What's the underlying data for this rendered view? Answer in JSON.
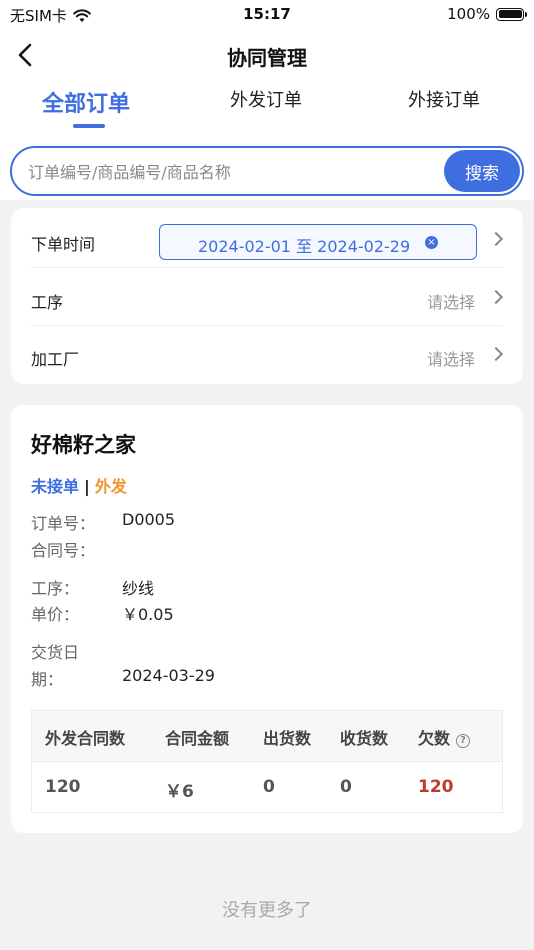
{
  "status_bar": {
    "carrier": "无SIM卡",
    "time": "15:17",
    "battery": "100%"
  },
  "nav": {
    "title": "协同管理"
  },
  "tabs": [
    {
      "label": "全部订单",
      "active": true
    },
    {
      "label": "外发订单",
      "active": false
    },
    {
      "label": "外接订单",
      "active": false
    }
  ],
  "search": {
    "placeholder": "订单编号/商品编号/商品名称",
    "value": "",
    "button_label": "搜索"
  },
  "filters": {
    "order_time": {
      "label": "下单时间",
      "value": "2024-02-01 至 2024-02-29"
    },
    "process": {
      "label": "工序",
      "value": "请选择"
    },
    "factory": {
      "label": "加工厂",
      "value": "请选择"
    }
  },
  "order": {
    "company": "好棉籽之家",
    "status": "未接单",
    "separator": "|",
    "type": "外发",
    "fields": {
      "order_no": {
        "label": "订单号：",
        "value": "D0005"
      },
      "contract_no": {
        "label": "合同号：",
        "value": ""
      },
      "process": {
        "label": "工序：",
        "value": "纱线"
      },
      "unit_price": {
        "label": "单价：",
        "value": "￥0.05"
      },
      "delivery_date": {
        "label_line1": "交货日",
        "label_line2": "期：",
        "value": "2024-03-29"
      }
    },
    "stats": {
      "headers": [
        "外发合同数",
        "合同金额",
        "出货数",
        "收货数",
        "欠数"
      ],
      "values": [
        "120",
        "￥6",
        "0",
        "0",
        "120"
      ]
    }
  },
  "footer": {
    "no_more": "没有更多了"
  },
  "colors": {
    "accent": "#3f6ee0",
    "orange": "#f0952a",
    "debt_red": "#c0392b"
  }
}
